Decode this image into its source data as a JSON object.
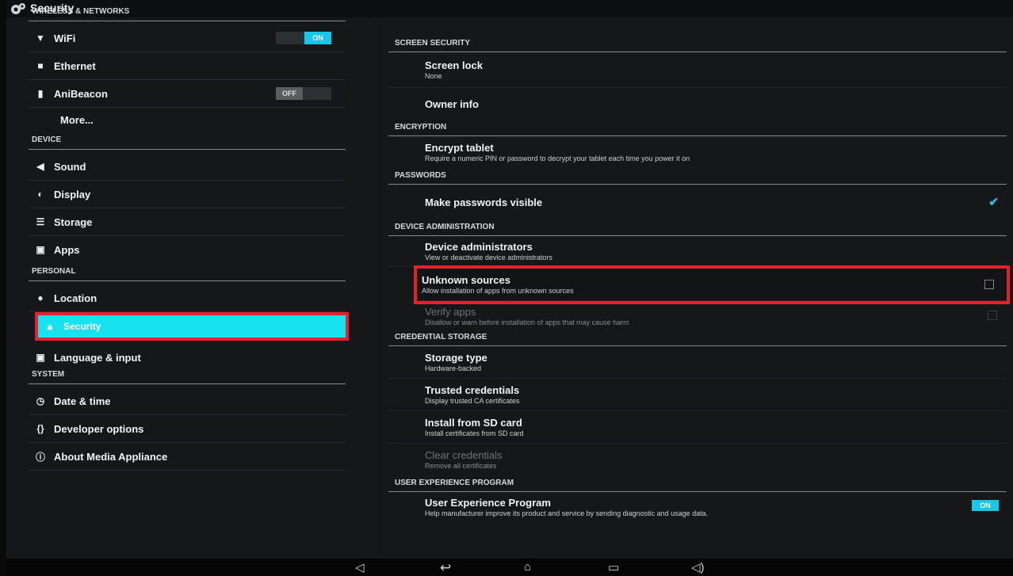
{
  "header": {
    "title": "Security",
    "icon": "gear-icon"
  },
  "left": {
    "sections": [
      {
        "title": "WIRELESS & NETWORKS",
        "items": [
          {
            "label": "WiFi",
            "icon": "wifi-icon",
            "toggle": "ON"
          },
          {
            "label": "Ethernet",
            "icon": "ethernet-icon"
          },
          {
            "label": "AniBeacon",
            "icon": "beacon-icon",
            "toggle": "OFF"
          },
          {
            "label": "More...",
            "icon": ""
          }
        ]
      },
      {
        "title": "DEVICE",
        "items": [
          {
            "label": "Sound",
            "icon": "sound-icon"
          },
          {
            "label": "Display",
            "icon": "display-icon"
          },
          {
            "label": "Storage",
            "icon": "storage-icon"
          },
          {
            "label": "Apps",
            "icon": "apps-icon"
          }
        ]
      },
      {
        "title": "PERSONAL",
        "items": [
          {
            "label": "Location",
            "icon": "location-icon"
          },
          {
            "label": "Security",
            "icon": "lock-icon",
            "selected": true
          },
          {
            "label": "Language & input",
            "icon": "language-icon"
          }
        ]
      },
      {
        "title": "SYSTEM",
        "items": [
          {
            "label": "Date & time",
            "icon": "clock-icon"
          },
          {
            "label": "Developer options",
            "icon": "braces-icon"
          },
          {
            "label": "About Media Appliance",
            "icon": "info-icon"
          }
        ]
      }
    ]
  },
  "right": {
    "screen_security": {
      "title": "SCREEN SECURITY",
      "screen_lock": {
        "title": "Screen lock",
        "summary": "None"
      },
      "owner_info": {
        "title": "Owner info"
      }
    },
    "encryption": {
      "title": "ENCRYPTION",
      "encrypt_tablet": {
        "title": "Encrypt tablet",
        "summary": "Require a numeric PIN or password to decrypt your tablet each time you power it on"
      }
    },
    "passwords": {
      "title": "PASSWORDS",
      "make_visible": {
        "title": "Make passwords visible",
        "checked": true
      }
    },
    "device_admin": {
      "title": "DEVICE ADMINISTRATION",
      "device_admins": {
        "title": "Device administrators",
        "summary": "View or deactivate device administrators"
      },
      "unknown_sources": {
        "title": "Unknown sources",
        "summary": "Allow installation of apps from unknown sources",
        "checked": false
      },
      "verify_apps": {
        "title": "Verify apps",
        "summary": "Disallow or warn before installation of apps that may cause harm",
        "checked": false
      }
    },
    "credential_storage": {
      "title": "CREDENTIAL STORAGE",
      "storage_type": {
        "title": "Storage type",
        "summary": "Hardware-backed"
      },
      "trusted_credentials": {
        "title": "Trusted credentials",
        "summary": "Display trusted CA certificates"
      },
      "install_sd": {
        "title": "Install from SD card",
        "summary": "Install certificates from SD card"
      },
      "clear_credentials": {
        "title": "Clear credentials",
        "summary": "Remove all certificates"
      }
    },
    "uxp": {
      "title": "USER EXPERIENCE PROGRAM",
      "program": {
        "title": "User Experience Program",
        "summary": "Help manufacturer improve its product and service by sending diagnostic and usage data.",
        "toggle": "ON"
      }
    }
  },
  "navbar": {
    "items": [
      "volume-down-icon",
      "back-icon",
      "home-icon",
      "recents-icon",
      "volume-up-icon"
    ]
  }
}
